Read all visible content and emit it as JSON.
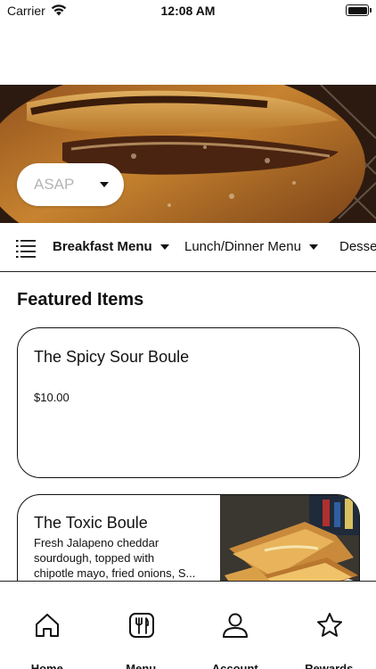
{
  "status_bar": {
    "carrier": "Carrier",
    "time": "12:08 AM"
  },
  "hero": {
    "image": "sourdough-bread-loaf",
    "order_time": "ASAP"
  },
  "menu_tabs": [
    {
      "label": "Breakfast Menu",
      "selected": true
    },
    {
      "label": "Lunch/Dinner Menu",
      "selected": false
    },
    {
      "label": "Desse",
      "selected": false
    }
  ],
  "featured": {
    "title": "Featured Items",
    "items": [
      {
        "name": "The Spicy Sour Boule",
        "price": "$10.00"
      },
      {
        "name": "The Toxic Boule",
        "description_lines": [
          "Fresh Jalapeno cheddar",
          "sourdough, topped with",
          "chipotle mayo, fried onions, S..."
        ],
        "image": "grilled-sandwich-photo"
      }
    ]
  },
  "bottom_nav": [
    {
      "label": "Home",
      "icon": "home-icon"
    },
    {
      "label": "Menu",
      "icon": "menu-utensils-icon"
    },
    {
      "label": "Account",
      "icon": "account-icon"
    },
    {
      "label": "Rewards",
      "icon": "star-icon"
    }
  ],
  "colors": {
    "text": "#111111",
    "placeholder": "#b5b5b5",
    "background": "#ffffff"
  }
}
